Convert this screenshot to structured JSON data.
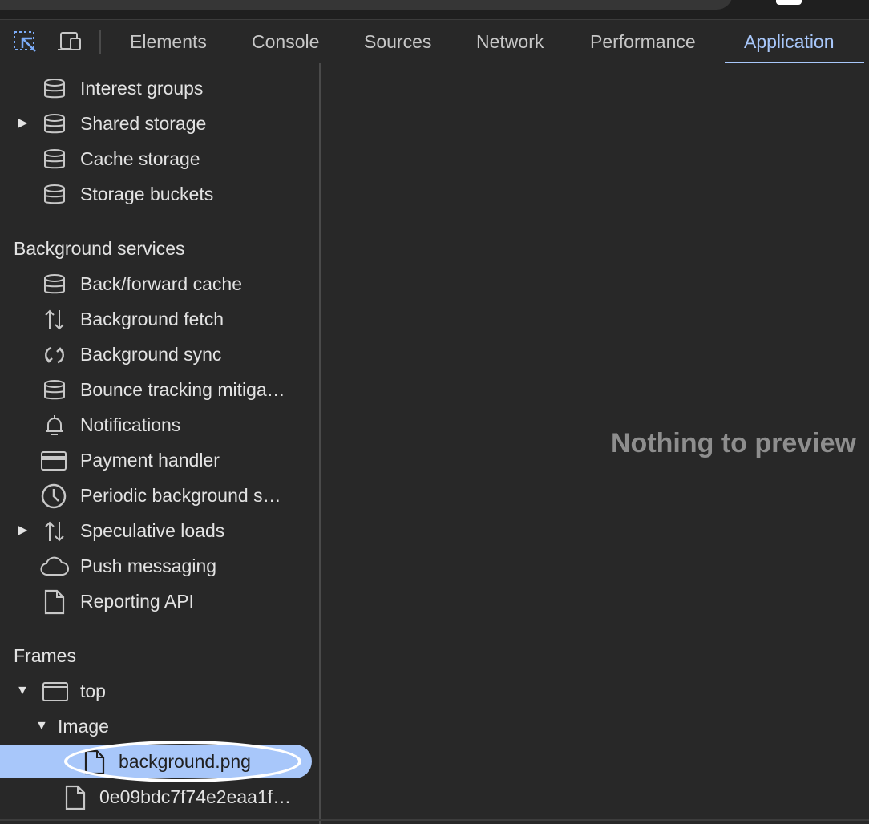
{
  "toolbar": {
    "tabs": [
      {
        "label": "Elements"
      },
      {
        "label": "Console"
      },
      {
        "label": "Sources"
      },
      {
        "label": "Network"
      },
      {
        "label": "Performance"
      },
      {
        "label": "Application"
      }
    ],
    "active_tab": "Application",
    "accent_color": "#a8c7fa"
  },
  "sidebar": {
    "storage_items": [
      {
        "label": "Interest groups",
        "icon": "database-icon"
      },
      {
        "label": "Shared storage",
        "icon": "database-icon",
        "expandable": true
      },
      {
        "label": "Cache storage",
        "icon": "database-icon"
      },
      {
        "label": "Storage buckets",
        "icon": "database-icon"
      }
    ],
    "background_services": {
      "header": "Background services",
      "items": [
        {
          "label": "Back/forward cache",
          "icon": "database-icon"
        },
        {
          "label": "Background fetch",
          "icon": "up-down-arrows-icon"
        },
        {
          "label": "Background sync",
          "icon": "sync-icon"
        },
        {
          "label": "Bounce tracking mitiga…",
          "icon": "database-icon"
        },
        {
          "label": "Notifications",
          "icon": "bell-icon"
        },
        {
          "label": "Payment handler",
          "icon": "credit-card-icon"
        },
        {
          "label": "Periodic background s…",
          "icon": "clock-icon"
        },
        {
          "label": "Speculative loads",
          "icon": "up-down-arrows-icon",
          "expandable": true
        },
        {
          "label": "Push messaging",
          "icon": "cloud-icon"
        },
        {
          "label": "Reporting API",
          "icon": "document-icon"
        }
      ]
    },
    "frames": {
      "header": "Frames",
      "top_label": "top",
      "image_label": "Image",
      "files": [
        {
          "label": "background.png",
          "selected": true
        },
        {
          "label": "0e09bdc7f74e2eaa1f…"
        }
      ]
    }
  },
  "main": {
    "empty_message": "Nothing to preview"
  }
}
